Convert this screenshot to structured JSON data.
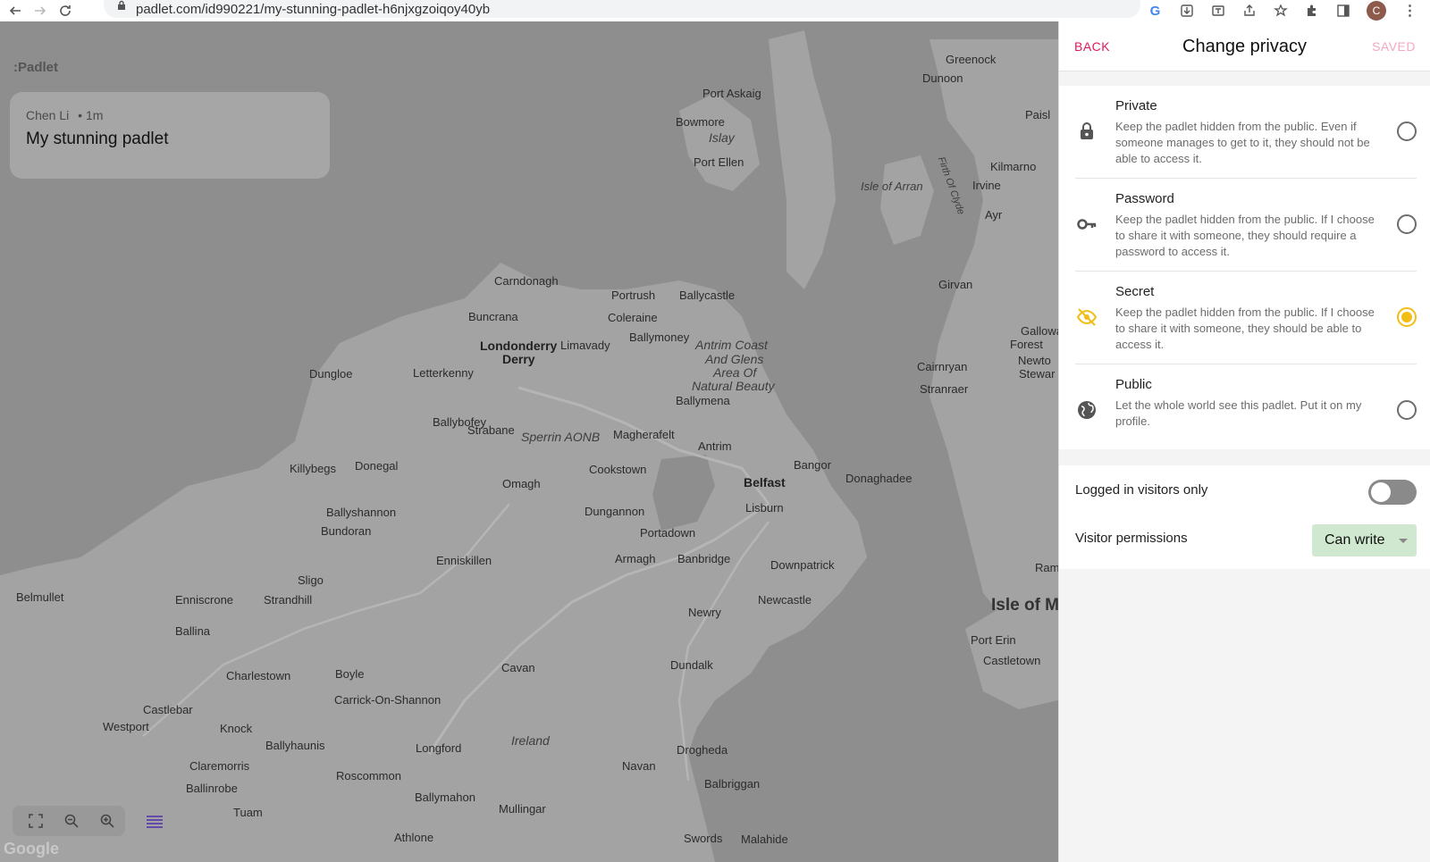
{
  "browser": {
    "url": "padlet.com/id990221/my-stunning-padlet-h6njxgzoiqoy40yb",
    "avatar_letter": "C"
  },
  "app": {
    "logo": ":Padlet"
  },
  "post": {
    "author": "Chen Li",
    "time": "• 1m",
    "title": "My stunning padlet"
  },
  "map": {
    "attribution": "Google",
    "places": [
      "Greenock",
      "Dunoon",
      "Port Askaig",
      "Bowmore",
      "Islay",
      "Port Ellen",
      "Isle of Arran",
      "Kilmarno",
      "Irvine",
      "Ayr",
      "Carndonagh",
      "Portrush",
      "Ballycastle",
      "Buncrana",
      "Coleraine",
      "Londonderry",
      "Derry",
      "Limavady",
      "Ballymoney",
      "Antrim Coast",
      "And Glens",
      "Area Of",
      "Natural Beauty",
      "Girvan",
      "Dungloe",
      "Letterkenny",
      "Ballymena",
      "Cairnryan",
      "Stranraer",
      "Ballybofey",
      "Strabane",
      "Sperrin AONB",
      "Magherafelt",
      "Antrim",
      "Bangor",
      "Donaghadee",
      "Killybegs",
      "Donegal",
      "Cookstown",
      "Belfast",
      "Omagh",
      "Dungannon",
      "Lisburn",
      "Ballyshannon",
      "Bundoran",
      "Portadown",
      "Enniskillen",
      "Armagh",
      "Banbridge",
      "Downpatrick",
      "Sligo",
      "Strandhill",
      "Belmullet",
      "Enniscrone",
      "Newcastle",
      "Isle of M",
      "Ballina",
      "Newry",
      "Port Erin",
      "Castletown",
      "Charlestown",
      "Boyle",
      "Cavan",
      "Dundalk",
      "Castlebar",
      "Carrick-On-Shannon",
      "Westport",
      "Knock",
      "Ireland",
      "Ballyhaunis",
      "Longford",
      "Drogheda",
      "Claremorris",
      "Navan",
      "Roscommon",
      "Ballinrobe",
      "Balbriggan",
      "Ballymahon",
      "Mullingar",
      "Tuam",
      "Athlone",
      "Swords",
      "Malahide",
      "Paisl",
      "Galloway",
      "Forest",
      "Newto",
      "Stewar",
      "Ram",
      "Firth Of Clyde"
    ]
  },
  "panel": {
    "back_label": "BACK",
    "title": "Change privacy",
    "saved_label": "SAVED",
    "options": [
      {
        "title": "Private",
        "description": "Keep the padlet hidden from the public. Even if someone manages to get to it, they should not be able to access it.",
        "icon": "lock-icon",
        "selected": false
      },
      {
        "title": "Password",
        "description": "Keep the padlet hidden from the public. If I choose to share it with someone, they should require a password to access it.",
        "icon": "key-icon",
        "selected": false
      },
      {
        "title": "Secret",
        "description": "Keep the padlet hidden from the public. If I choose to share it with someone, they should be able to access it.",
        "icon": "eye-off-icon",
        "selected": true
      },
      {
        "title": "Public",
        "description": "Let the whole world see this padlet. Put it on my profile.",
        "icon": "globe-icon",
        "selected": false
      }
    ],
    "logged_in_label": "Logged in visitors only",
    "logged_in_enabled": false,
    "visitor_permissions_label": "Visitor permissions",
    "visitor_permissions_value": "Can write"
  },
  "colors": {
    "accent": "#e0195e",
    "selected": "#f1be18",
    "permission_bg": "#cfe8cf"
  }
}
